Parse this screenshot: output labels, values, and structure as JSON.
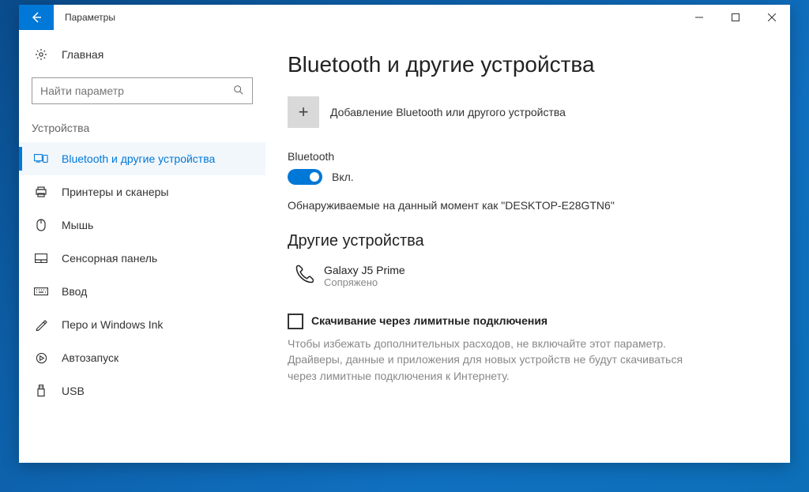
{
  "window": {
    "title": "Параметры"
  },
  "sidebar": {
    "home": "Главная",
    "search_placeholder": "Найти параметр",
    "group_label": "Устройства",
    "items": [
      {
        "label": "Bluetooth и другие устройства"
      },
      {
        "label": "Принтеры и сканеры"
      },
      {
        "label": "Мышь"
      },
      {
        "label": "Сенсорная панель"
      },
      {
        "label": "Ввод"
      },
      {
        "label": "Перо и Windows Ink"
      },
      {
        "label": "Автозапуск"
      },
      {
        "label": "USB"
      }
    ]
  },
  "main": {
    "heading": "Bluetooth и другие устройства",
    "add_device": "Добавление Bluetooth или другого устройства",
    "bt_section_label": "Bluetooth",
    "bt_toggle_state": "Вкл.",
    "discoverable": "Обнаруживаемые на данный момент как \"DESKTOP-E28GTN6\"",
    "other_devices_heading": "Другие устройства",
    "device": {
      "name": "Galaxy J5 Prime",
      "status": "Сопряжено"
    },
    "metered_checkbox_label": "Скачивание через лимитные подключения",
    "metered_help": "Чтобы избежать дополнительных расходов, не включайте этот параметр. Драйверы, данные и приложения для новых устройств не будут скачиваться через лимитные подключения к Интернету."
  }
}
